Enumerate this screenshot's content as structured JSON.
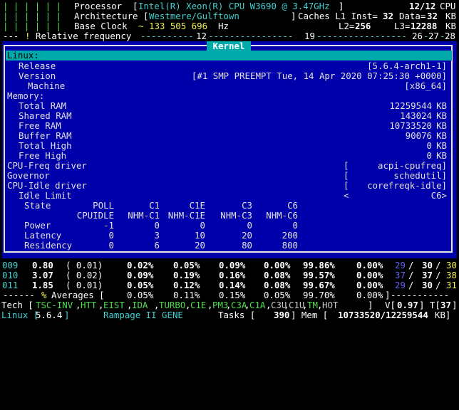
{
  "header": {
    "processor_label": "Processor",
    "processor_value": "Intel(R) Xeon(R) CPU W3690 @ 3.47GHz",
    "cpu_count": "12/12",
    "cpu_label": "CPU",
    "arch_label": "Architecture",
    "arch_value": "Westmere/Gulftown",
    "caches_label": "Caches L1 Inst=",
    "l1_inst": "32",
    "data_label": "Data=",
    "l1_data": "32",
    "kb1": "KB",
    "base_clock_label": "Base Clock",
    "base_clock_value": "133 505 696",
    "hz": "Hz",
    "l2_label": "L2=",
    "l2_value": "256",
    "l3_label": "L3=",
    "l3_value": "12288",
    "kb2": "KB",
    "bars_1": "| | | | | |",
    "bars_2": "| | | | | |",
    "bars_3": "| | | | | |",
    "freq_left": "---",
    "freq_label": "Relative frequency",
    "freq_12": "12",
    "freq_19": "19",
    "freq_26": "26",
    "freq_27": "27",
    "freq_28": "28"
  },
  "kernel": {
    "title": "Kernel",
    "linux_label": "Linux:",
    "release_label": "Release",
    "release_value": "[5.6.4-arch1-1]",
    "version_label": "Version",
    "version_value": "[#1 SMP PREEMPT Tue, 14 Apr 2020 07:25:30 +0000]",
    "machine_label": "Machine",
    "machine_value": "[x86_64]",
    "memory_label": "Memory:",
    "mem": [
      {
        "label": "Total RAM",
        "value": "12259544",
        "unit": "KB"
      },
      {
        "label": "Shared RAM",
        "value": "143024",
        "unit": "KB"
      },
      {
        "label": "Free RAM",
        "value": "10733520",
        "unit": "KB"
      },
      {
        "label": "Buffer RAM",
        "value": "90076",
        "unit": "KB"
      },
      {
        "label": "Total High",
        "value": "0",
        "unit": "KB"
      },
      {
        "label": "Free High",
        "value": "0",
        "unit": "KB"
      }
    ],
    "cpufreq_label": "CPU-Freq driver",
    "cpufreq_value": "acpi-cpufreq]",
    "governor_label": "Governor",
    "governor_value": "schedutil]",
    "cpuidle_label": "CPU-Idle driver",
    "cpuidle_value": "corefreqk-idle]",
    "idle_limit_label": "Idle Limit",
    "idle_limit_value": "C6>",
    "state_label": "State",
    "states_top": [
      "POLL",
      "C1",
      "C1E",
      "C3",
      "C6"
    ],
    "states_bottom": [
      "CPUIDLE",
      "NHM-C1",
      "NHM-C1E",
      "NHM-C3",
      "NHM-C6"
    ],
    "power_label": "Power",
    "power": [
      "-1",
      "0",
      "0",
      "0",
      "0"
    ],
    "latency_label": "Latency",
    "latency": [
      "0",
      "3",
      "10",
      "20",
      "200"
    ],
    "residency_label": "Residency",
    "residency": [
      "0",
      "6",
      "20",
      "80",
      "800"
    ]
  },
  "cpus": [
    {
      "id": "009",
      "freq": "0.80",
      "ratio": "( 0.01)",
      "c0": "0.02%",
      "c1": "0.05%",
      "c3": "0.09%",
      "c6": "0.00%",
      "c7": "99.86%",
      "x": "0.00%",
      "t1": "29",
      "t2": "30",
      "t3": "30"
    },
    {
      "id": "010",
      "freq": "3.07",
      "ratio": "( 0.02)",
      "c0": "0.09%",
      "c1": "0.19%",
      "c3": "0.16%",
      "c6": "0.08%",
      "c7": "99.57%",
      "x": "0.00%",
      "t1": "37",
      "t2": "37",
      "t3": "38"
    },
    {
      "id": "011",
      "freq": "1.85",
      "ratio": "( 0.01)",
      "c0": "0.05%",
      "c1": "0.12%",
      "c3": "0.14%",
      "c6": "0.08%",
      "c7": "99.67%",
      "x": "0.00%",
      "t1": "29",
      "t2": "30",
      "t3": "31"
    }
  ],
  "averages": {
    "label": "% Averages [",
    "values": [
      "0.05%",
      "0.11%",
      "0.15%",
      "0.05%",
      "99.70%",
      "0.00%"
    ],
    "close": "]"
  },
  "tech": {
    "label": "Tech [",
    "items": [
      "TSC-INV",
      "HTT",
      "EIST",
      "IDA",
      "TURBO",
      "C1E",
      "PM3",
      "C3A",
      "C1A",
      "C3U",
      "C1U",
      "TM",
      "HOT"
    ],
    "close": "]",
    "v_label": "V[",
    "v_value": "0.97",
    "t_label": "] T[",
    "t_value": "37",
    "t_close": "]"
  },
  "status": {
    "os": "Linux [",
    "kernel": "5.6.4",
    "os_close": "]",
    "board": "Rampage II GENE",
    "tasks_label": "Tasks [",
    "tasks_value": "390",
    "mem_label": "] Mem [",
    "mem_value": "10733520/12259544",
    "mem_unit": "KB]"
  }
}
